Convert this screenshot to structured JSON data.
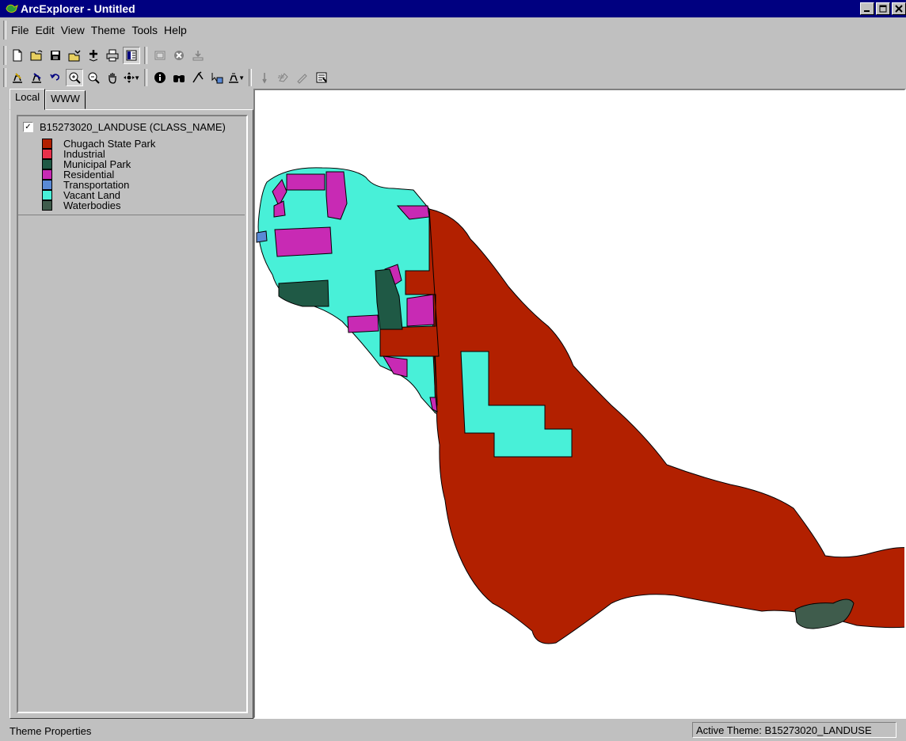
{
  "window": {
    "title": "ArcExplorer - Untitled"
  },
  "menu": [
    "File",
    "Edit",
    "View",
    "Theme",
    "Tools",
    "Help"
  ],
  "toolbar1": [
    "new-icon",
    "open-icon",
    "save-icon",
    "open-project-icon",
    "add-theme-icon",
    "print-icon",
    "toggle-legend-icon",
    "sep",
    "map-window-icon",
    "stop-icon",
    "export-icon"
  ],
  "toolbar2": [
    "theme-properties-icon",
    "query-builder-icon",
    "undo-icon",
    "zoom-in-icon",
    "zoom-out-icon",
    "pan-icon",
    "pan-dropdown-icon",
    "sep",
    "identify-icon",
    "find-icon",
    "measure-icon",
    "select-icon",
    "sep2",
    "geocode-icon",
    "clear-icon",
    "eraser-icon",
    "properties-icon"
  ],
  "tabs": {
    "local": "Local",
    "www": "WWW"
  },
  "theme": {
    "name": "B15273020_LANDUSE (CLASS_NAME)",
    "checked": "✓"
  },
  "legend": [
    {
      "label": "Chugach State Park",
      "color": "#b22000"
    },
    {
      "label": "Industrial",
      "color": "#e8304a"
    },
    {
      "label": "Municipal Park",
      "color": "#1f5945"
    },
    {
      "label": "Residential",
      "color": "#c82ab4"
    },
    {
      "label": "Transportation",
      "color": "#5a8ad6"
    },
    {
      "label": "Vacant Land",
      "color": "#48f0d8"
    },
    {
      "label": "Waterbodies",
      "color": "#3f5c4c"
    }
  ],
  "status": {
    "left": "Theme Properties",
    "right": "Active Theme: B15273020_LANDUSE"
  }
}
